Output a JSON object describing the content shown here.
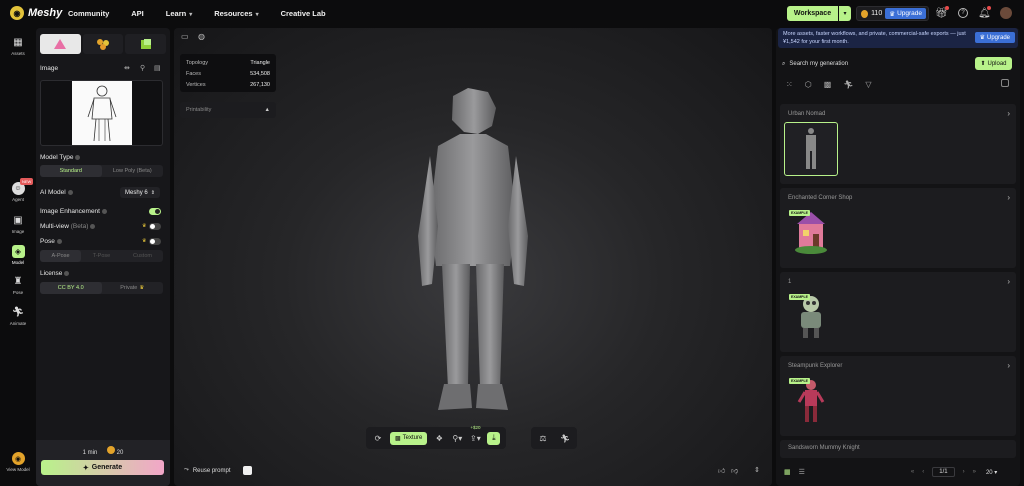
{
  "nav": {
    "brand": "Meshy",
    "links": [
      {
        "label": "Community",
        "caret": false
      },
      {
        "label": "API",
        "caret": false
      },
      {
        "label": "Learn",
        "caret": true
      },
      {
        "label": "Resources",
        "caret": true
      },
      {
        "label": "Creative Lab",
        "caret": false
      }
    ],
    "workspace_label": "Workspace",
    "credits": "110",
    "upgrade_label": "Upgrade"
  },
  "rail": {
    "items": [
      {
        "label": "Assets",
        "icon": "grid-icon"
      },
      {
        "label": "Agent",
        "icon": "agent-icon",
        "badge": "NEW"
      },
      {
        "label": "Image",
        "icon": "image-icon"
      },
      {
        "label": "Model",
        "icon": "cube-icon"
      },
      {
        "label": "Pose",
        "icon": "pose-icon"
      },
      {
        "label": "Animate",
        "icon": "run-icon"
      },
      {
        "label": "View Model",
        "icon": "view-model-icon"
      }
    ]
  },
  "left": {
    "image_label": "Image",
    "model_type_label": "Model Type",
    "model_type_options": [
      "Standard",
      "Low Poly (Beta)"
    ],
    "ai_model_label": "AI Model",
    "ai_model_value": "Meshy 6",
    "image_enhancement_label": "Image Enhancement",
    "multiview_label": "Multi-view",
    "multiview_suffix": "(Beta)",
    "pose_label": "Pose",
    "pose_options": [
      "A-Pose",
      "T-Pose",
      "Custom"
    ],
    "license_label": "License",
    "license_options": [
      "CC BY 4.0",
      "Private"
    ],
    "gen_time": "1 min",
    "gen_cost": "20",
    "generate_label": "Generate"
  },
  "viewport": {
    "stats": [
      {
        "label": "Topology",
        "value": "Triangle"
      },
      {
        "label": "Faces",
        "value": "534,508"
      },
      {
        "label": "Vertices",
        "value": "267,130"
      }
    ],
    "printability_label": "Printability",
    "texture_label": "Texture",
    "texture_extra": "+$20",
    "reuse_prompt_label": "Reuse prompt"
  },
  "right": {
    "promo_text": "More assets, faster workflows, and private, commercial-safe exports — just ¥1,542 for your first month.",
    "promo_upgrade": "Upgrade",
    "search_placeholder": "Search my generation",
    "upload_label": "Upload",
    "example_badge": "EXAMPLE",
    "groups": [
      {
        "title": "Urban Nomad"
      },
      {
        "title": "Enchanted Corner Shop"
      },
      {
        "title": "1"
      },
      {
        "title": "Steampunk Explorer"
      },
      {
        "title": "Sandsworn Mummy Knight"
      }
    ],
    "pager_value": "1/1",
    "page_size": "20"
  },
  "colors": {
    "accent": "#b8f28a",
    "upgrade_blue": "#3b6fd6",
    "generate_pink": "#f2a6c8"
  }
}
